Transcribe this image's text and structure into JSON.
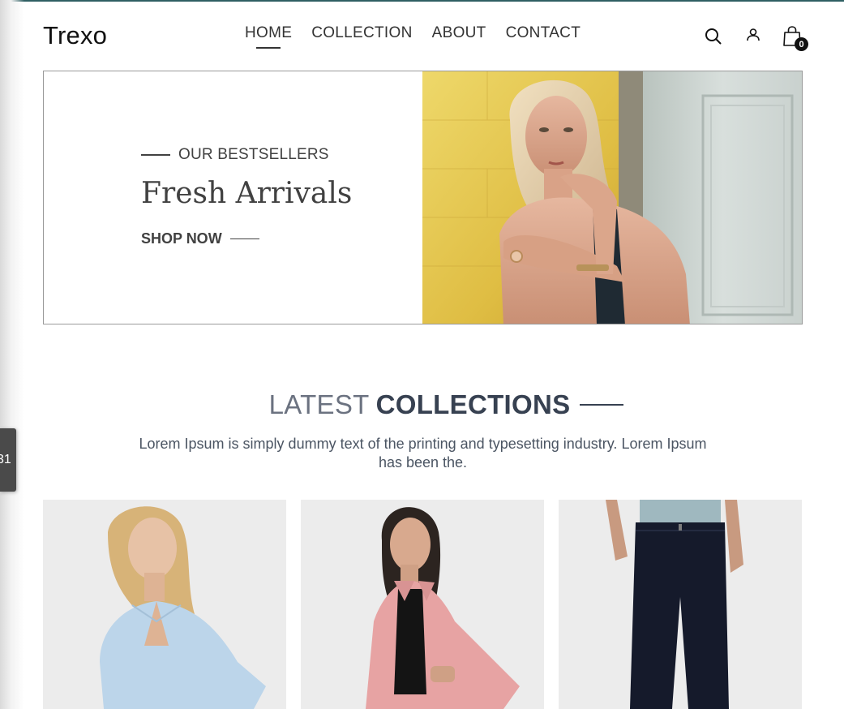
{
  "brand": {
    "logo": "Trexo"
  },
  "nav": {
    "items": [
      {
        "label": "HOME",
        "active": true
      },
      {
        "label": "COLLECTION",
        "active": false
      },
      {
        "label": "ABOUT",
        "active": false
      },
      {
        "label": "CONTACT",
        "active": false
      }
    ]
  },
  "header_icons": {
    "search": "search-icon",
    "profile": "user-icon",
    "cart": "shopping-bag-icon",
    "cart_count": "0"
  },
  "side_tab": {
    "text": "31"
  },
  "hero": {
    "eyebrow": "OUR BESTSELLERS",
    "title": "Fresh Arrivals",
    "cta": "SHOP NOW"
  },
  "latest": {
    "title_light": "LATEST",
    "title_bold": "COLLECTIONS",
    "description": "Lorem Ipsum is simply dummy text of the printing and typesetting industry. Lorem Ipsum has been the."
  },
  "colors": {
    "text_dark": "#414141",
    "heading_gray": "#6b7280",
    "heading_dark": "#374151",
    "hero_yellow": "#e3c24a"
  }
}
